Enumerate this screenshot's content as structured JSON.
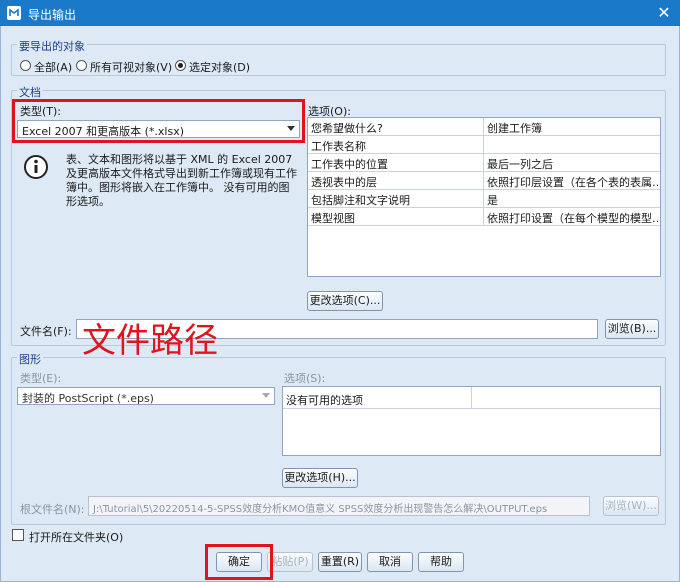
{
  "window": {
    "title": "导出输出",
    "close_symbol": "✕"
  },
  "objects_group": {
    "legend": "要导出的对象",
    "options": [
      {
        "label": "全部(A)",
        "selected": false
      },
      {
        "label": "所有可视对象(V)",
        "selected": false
      },
      {
        "label": "选定对象(D)",
        "selected": true
      }
    ]
  },
  "document_group": {
    "legend": "文档",
    "type_label": "类型(T):",
    "type_value": "Excel 2007 和更高版本 (*.xlsx)",
    "info_text": "表、文本和图形将以基于 XML 的 Excel 2007 及更高版本文件格式导出到新工作簿或现有工作簿中。图形将嵌入在工作簿中。 没有可用的图形选项。",
    "options_label": "选项(O):",
    "options_table": [
      [
        "您希望做什么?",
        "创建工作簿"
      ],
      [
        "工作表名称",
        ""
      ],
      [
        "工作表中的位置",
        "最后一列之后"
      ],
      [
        "透视表中的层",
        "依照打印层设置（在各个表的表属…"
      ],
      [
        "包括脚注和文字说明",
        "是"
      ],
      [
        "模型视图",
        "依照打印设置（在每个模型的模型…"
      ]
    ],
    "change_options_button": "更改选项(C)...",
    "filename_label": "文件名(F):",
    "filename_value": "",
    "browse_button": "浏览(B)..."
  },
  "annotation": {
    "text": "文件路径"
  },
  "graphics_group": {
    "legend": "图形",
    "type_label": "类型(E):",
    "type_value": "封装的 PostScript (*.eps)",
    "options_label": "选项(S):",
    "options_table": [
      [
        "没有可用的选项",
        ""
      ]
    ],
    "change_options_button": "更改选项(H)...",
    "root_filename_label": "根文件名(N):",
    "root_filename_value": "J:\\Tutorial\\5\\20220514-5-SPSS效度分析KMO值意义 SPSS效度分析出现警告怎么解决\\OUTPUT.eps",
    "browse_button": "浏览(W)..."
  },
  "open_folder": {
    "label": "打开所在文件夹(O)",
    "checked": false
  },
  "buttons": {
    "ok": "确定",
    "paste": "粘贴(P)",
    "reset": "重置(R)",
    "cancel": "取消",
    "help": "帮助"
  },
  "colors": {
    "highlight": "#e0141e",
    "titlebar": "#1a79c9"
  }
}
